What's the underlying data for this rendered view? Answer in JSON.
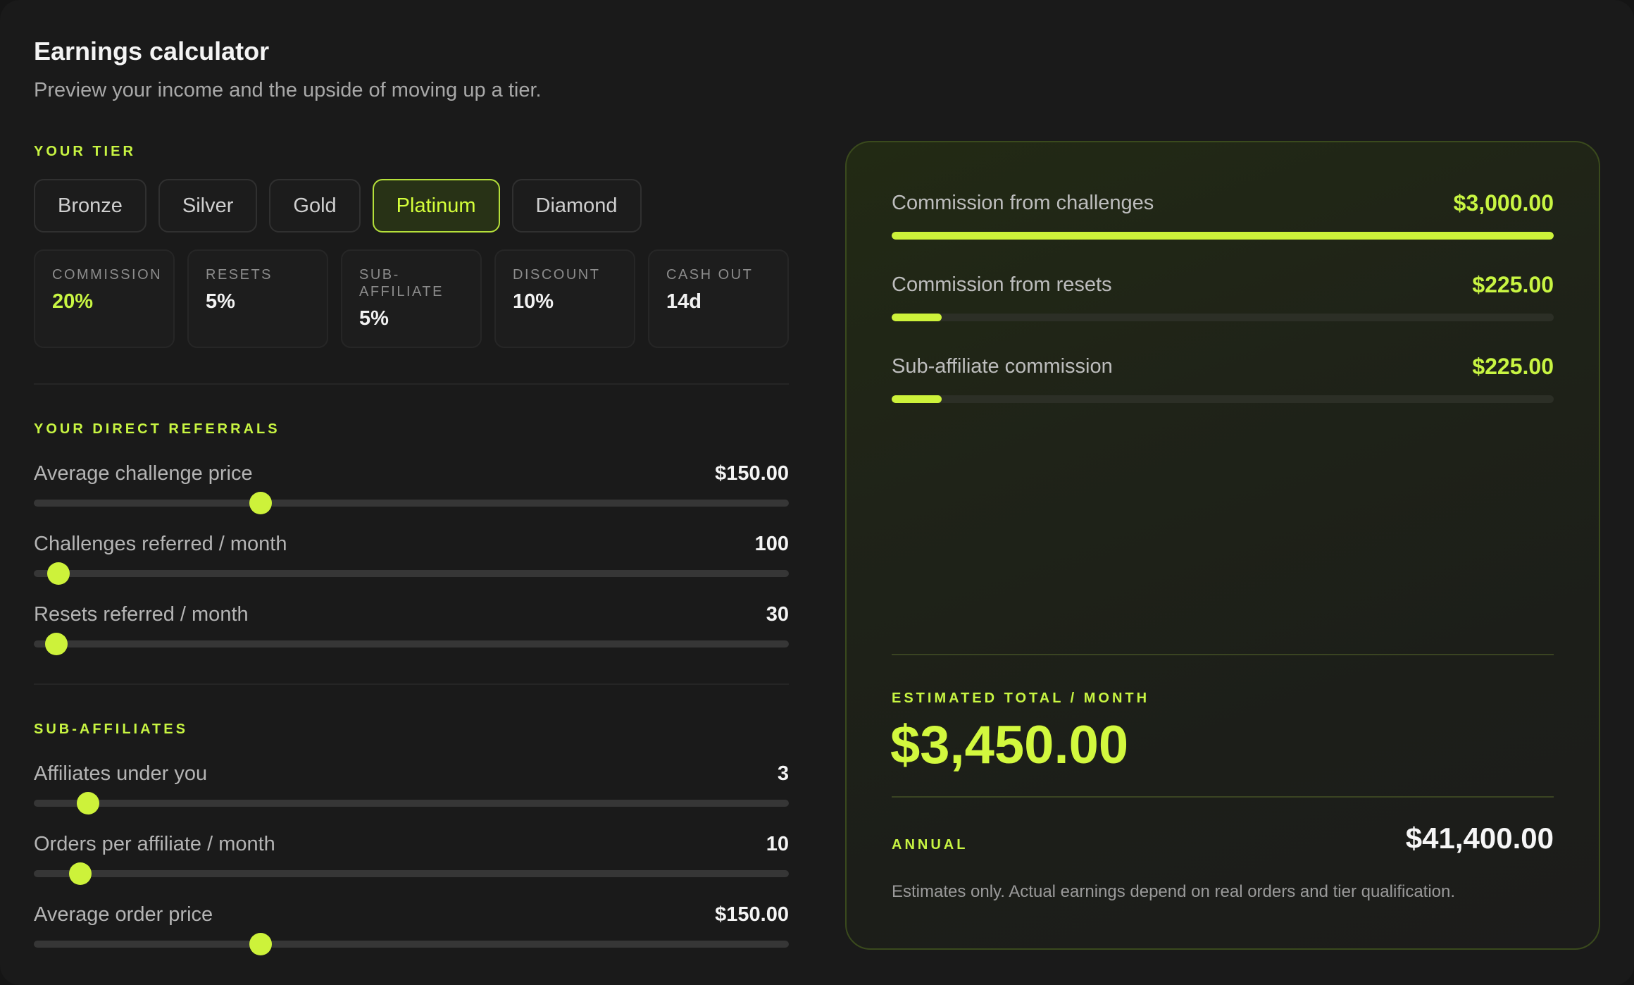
{
  "header": {
    "title": "Earnings calculator",
    "subtitle": "Preview your income and the upside of moving up a tier."
  },
  "tier_section": {
    "label": "YOUR TIER",
    "tiers": [
      "Bronze",
      "Silver",
      "Gold",
      "Platinum",
      "Diamond"
    ],
    "selected": "Platinum"
  },
  "stats": [
    {
      "label": "COMMISSION",
      "value": "20%"
    },
    {
      "label": "RESETS",
      "value": "5%"
    },
    {
      "label": "SUB-\nAFFILIATE",
      "value": "5%"
    },
    {
      "label": "DISCOUNT",
      "value": "10%"
    },
    {
      "label": "CASH OUT",
      "value": "14d"
    }
  ],
  "direct_referrals": {
    "label": "YOUR DIRECT REFERRALS",
    "sliders": [
      {
        "label": "Average challenge price",
        "value": "$150.00",
        "level": 0.3
      },
      {
        "label": "Challenges referred / month",
        "value": "100",
        "level": 0.033
      },
      {
        "label": "Resets referred / month",
        "value": "30",
        "level": 0.03
      }
    ]
  },
  "sub_affiliates": {
    "label": "SUB-AFFILIATES",
    "sliders": [
      {
        "label": "Affiliates under you",
        "value": "3",
        "level": 0.072
      },
      {
        "label": "Orders per affiliate / month",
        "value": "10",
        "level": 0.062
      },
      {
        "label": "Average order price",
        "value": "$150.00",
        "level": 0.3
      }
    ]
  },
  "results": {
    "breakdown": [
      {
        "label": "Commission from challenges",
        "value": "$3,000.00",
        "fill": 1.0
      },
      {
        "label": "Commission from resets",
        "value": "$225.00",
        "fill": 0.075
      },
      {
        "label": "Sub-affiliate commission",
        "value": "$225.00",
        "fill": 0.075
      }
    ],
    "estimated_label": "ESTIMATED TOTAL / MONTH",
    "estimated_value": "$3,450.00",
    "annual_label": "ANNUAL",
    "annual_value": "$41,400.00",
    "disclaimer": "Estimates only. Actual earnings depend on real orders and tier qualification."
  },
  "colors": {
    "accent": "#c8f542",
    "background": "#1a1a1a"
  }
}
